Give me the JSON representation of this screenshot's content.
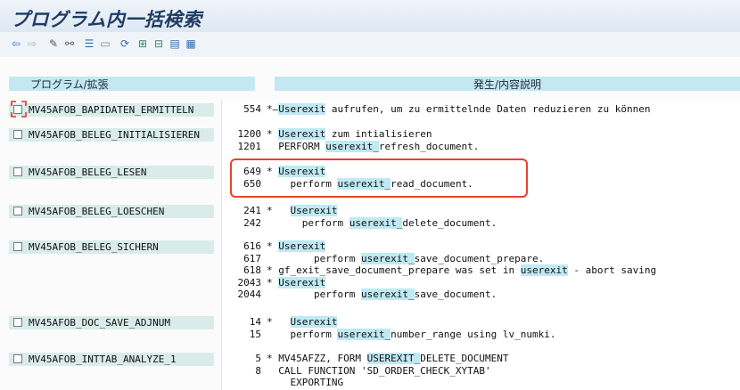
{
  "title": "プログラム内一括検索",
  "toolbar": {
    "icons": [
      "back-arrow-icon",
      "forward-arrow-icon",
      "edit-pencil-icon",
      "where-used-icon",
      "sort-icon",
      "window-icon",
      "refresh-icon",
      "expand-icon",
      "collapse-icon",
      "print-icon",
      "export-icon"
    ]
  },
  "headers": {
    "left": "プログラム/拡張",
    "right": "発生/内容説明"
  },
  "rows": [
    {
      "name": "MV45AFOB_BAPIDATEN_ERMITTELN",
      "lines": [
        {
          "num": "554",
          "pre": "*—",
          "hl": "Userexit",
          "post": " aufrufen, um zu ermittelnde Daten reduzieren zu können"
        }
      ]
    },
    {
      "name": "MV45AFOB_BELEG_INITIALISIEREN",
      "lines": [
        {
          "num": "1200",
          "pre": "* ",
          "hl": "Userexit",
          "post": " zum intialisieren"
        },
        {
          "num": "1201",
          "pre": "  PERFORM ",
          "hl": "userexit_",
          "post": "refresh_document."
        }
      ]
    },
    {
      "name": "MV45AFOB_BELEG_LESEN",
      "lines": [
        {
          "num": "649",
          "pre": "* ",
          "hl": "Userexit",
          "post": ""
        },
        {
          "num": "650",
          "pre": "    perform ",
          "hl": "userexit_",
          "post": "read_document."
        }
      ]
    },
    {
      "name": "MV45AFOB_BELEG_LOESCHEN",
      "lines": [
        {
          "num": "241",
          "pre": "*   ",
          "hl": "Userexit",
          "post": ""
        },
        {
          "num": "242",
          "pre": "      perform ",
          "hl": "userexit_",
          "post": "delete_document."
        }
      ]
    },
    {
      "name": "MV45AFOB_BELEG_SICHERN",
      "lines": [
        {
          "num": "616",
          "pre": "* ",
          "hl": "Userexit",
          "post": ""
        },
        {
          "num": "617",
          "pre": "        perform ",
          "hl": "userexit_",
          "post": "save_document_prepare."
        },
        {
          "num": "618",
          "pre": "* gf_exit_save_document_prepare was set in ",
          "hl": "userexit",
          "post": " - abort saving"
        },
        {
          "num": "2043",
          "pre": "* ",
          "hl": "Userexit",
          "post": ""
        },
        {
          "num": "2044",
          "pre": "        perform ",
          "hl": "userexit_",
          "post": "save_document."
        }
      ]
    },
    {
      "name": "MV45AFOB_DOC_SAVE_ADJNUM",
      "lines": [
        {
          "num": "14",
          "pre": "*   ",
          "hl": "Userexit",
          "post": ""
        },
        {
          "num": "15",
          "pre": "    perform ",
          "hl": "userexit_",
          "post": "number_range using lv_numki."
        }
      ]
    },
    {
      "name": "MV45AFOB_INTTAB_ANALYZE_1",
      "lines": [
        {
          "num": "5",
          "pre": "* MV45AFZZ, FORM ",
          "hl": "USEREXIT_",
          "post": "DELETE_DOCUMENT"
        },
        {
          "num": "8",
          "pre": "  CALL FUNCTION 'SD_ORDER_CHECK_XYTAB'",
          "hl": "",
          "post": ""
        },
        {
          "num": "",
          "pre": "    EXPORTING",
          "hl": "",
          "post": ""
        }
      ]
    }
  ],
  "colors": {
    "highlight": "#bfe9f3",
    "header": "#c4e8f2",
    "annotation": "#e8412e"
  }
}
